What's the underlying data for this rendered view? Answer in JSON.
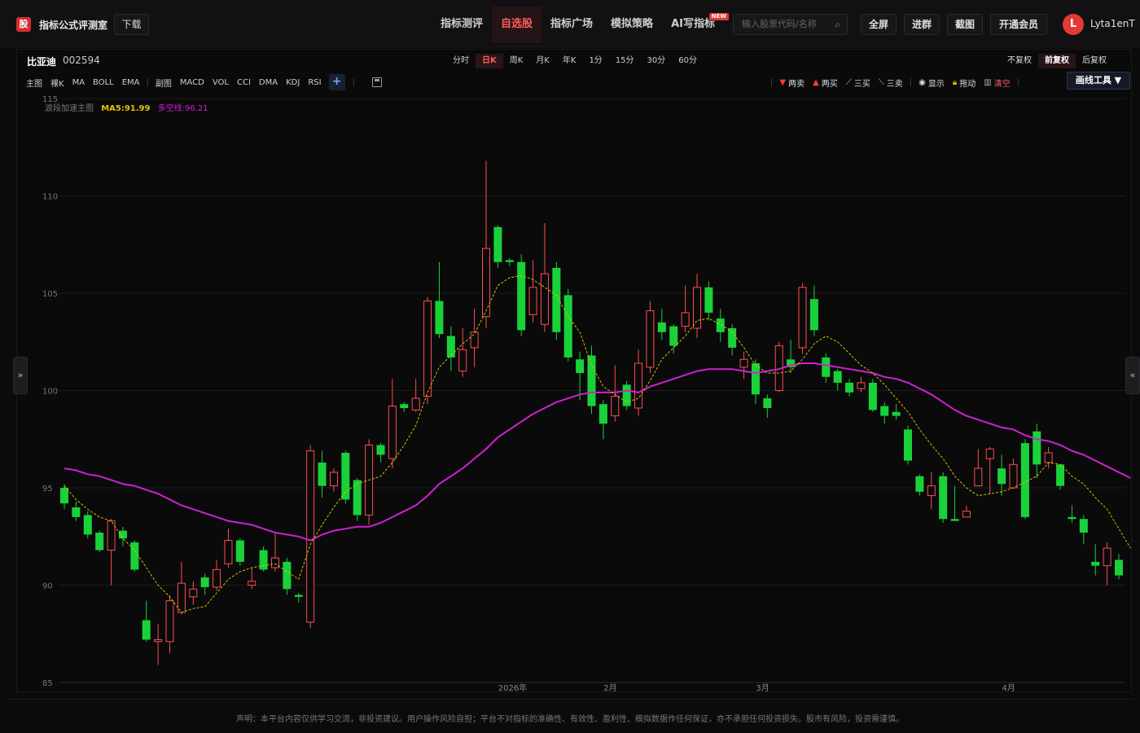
{
  "app": {
    "logo_glyph": "股",
    "title": "指标公式评测室",
    "download_label": "下载"
  },
  "nav": {
    "items": [
      {
        "label": "指标测评",
        "active": false
      },
      {
        "label": "自选股",
        "active": true
      },
      {
        "label": "指标广场",
        "active": false
      },
      {
        "label": "模拟策略",
        "active": false
      },
      {
        "label": "AI写指标",
        "active": false,
        "badge": "NEW"
      }
    ]
  },
  "search": {
    "placeholder": "输入股票代码/名称",
    "icon": "search-icon"
  },
  "top_buttons": {
    "fullscreen": "全屏",
    "join_group": "进群",
    "screenshot": "截图",
    "membership": "开通会员"
  },
  "user": {
    "avatar_letter": "L",
    "name": "Lyta1enT"
  },
  "stock": {
    "name": "比亚迪",
    "code": "002594"
  },
  "periods": [
    {
      "label": "分时",
      "active": false
    },
    {
      "label": "日K",
      "active": true
    },
    {
      "label": "周K",
      "active": false
    },
    {
      "label": "月K",
      "active": false
    },
    {
      "label": "年K",
      "active": false
    },
    {
      "label": "1分",
      "active": false
    },
    {
      "label": "15分",
      "active": false
    },
    {
      "label": "30分",
      "active": false
    },
    {
      "label": "60分",
      "active": false
    }
  ],
  "adjust_modes": [
    {
      "label": "不复权",
      "active": false
    },
    {
      "label": "前复权",
      "active": true
    },
    {
      "label": "后复权",
      "active": false
    }
  ],
  "main_indicators": {
    "group_label": "主图",
    "items": [
      "裸K",
      "MA",
      "BOLL",
      "EMA"
    ]
  },
  "sub_indicators": {
    "group_label": "副图",
    "items": [
      "MACD",
      "VOL",
      "CCI",
      "DMA",
      "KDJ",
      "RSI"
    ]
  },
  "add_label": "+",
  "draw_tools": {
    "items": [
      {
        "label": "两卖",
        "icon": "down-triangle-icon",
        "color": "#ff3b3b"
      },
      {
        "label": "两买",
        "icon": "up-triangle-icon",
        "color": "#ff3b3b"
      },
      {
        "label": "三买",
        "icon": "trend-line-icon"
      },
      {
        "label": "三卖",
        "icon": "diagonal-line-icon"
      },
      {
        "label": "显示",
        "icon": "eye-icon"
      },
      {
        "label": "拖动",
        "icon": "lock-icon"
      },
      {
        "label": "清空",
        "icon": "trash-icon",
        "color": "#ff5a5a"
      }
    ],
    "menu_label": "画线工具 ▼"
  },
  "side_buttons": {
    "left": "»",
    "right": "«"
  },
  "legend": {
    "main": "波段加速主图",
    "ma5": "MA5:91.99",
    "duokong": "多空线:96.21"
  },
  "chart_data": {
    "type": "candlestick",
    "ylim": [
      85,
      115
    ],
    "y_ticks": [
      85,
      90,
      95,
      100,
      105,
      110,
      115
    ],
    "x_labels": [
      {
        "label": "2026年",
        "index": 38
      },
      {
        "label": "2月",
        "index": 47
      },
      {
        "label": "3月",
        "index": 60
      },
      {
        "label": "4月",
        "index": 81
      }
    ],
    "up_color": "#ff4d4d",
    "down_color": "#19d23a",
    "ma5_color": "#d4c200",
    "duokong_color": "#d020d0",
    "candles": [
      [
        95.0,
        94.2,
        95.2,
        93.9
      ],
      [
        94.0,
        93.5,
        94.3,
        93.3
      ],
      [
        93.6,
        92.6,
        93.8,
        92.4
      ],
      [
        92.7,
        91.8,
        92.8,
        91.7
      ],
      [
        91.8,
        93.3,
        93.4,
        90.0
      ],
      [
        92.8,
        92.4,
        93.0,
        92.0
      ],
      [
        92.2,
        90.8,
        92.3,
        90.7
      ],
      [
        88.2,
        87.2,
        89.2,
        87.1
      ],
      [
        87.1,
        87.2,
        88.0,
        85.9
      ],
      [
        87.1,
        89.2,
        89.5,
        86.5
      ],
      [
        88.6,
        90.1,
        91.2,
        88.5
      ],
      [
        89.4,
        89.8,
        90.2,
        89.0
      ],
      [
        90.4,
        89.9,
        90.6,
        89.5
      ],
      [
        89.9,
        90.8,
        91.3,
        89.7
      ],
      [
        91.1,
        92.3,
        92.9,
        90.9
      ],
      [
        92.3,
        91.2,
        92.4,
        91.0
      ],
      [
        90.0,
        90.2,
        90.9,
        89.8
      ],
      [
        91.8,
        90.8,
        92.0,
        90.7
      ],
      [
        90.9,
        91.4,
        92.7,
        90.7
      ],
      [
        91.2,
        89.8,
        91.4,
        89.5
      ],
      [
        89.5,
        89.4,
        89.6,
        89.1
      ],
      [
        88.1,
        96.9,
        97.2,
        87.8
      ],
      [
        96.3,
        95.1,
        96.9,
        94.5
      ],
      [
        95.1,
        95.8,
        96.0,
        94.8
      ],
      [
        96.8,
        94.4,
        96.9,
        94.2
      ],
      [
        95.4,
        93.6,
        95.5,
        93.3
      ],
      [
        93.6,
        97.2,
        97.5,
        93.1
      ],
      [
        97.2,
        96.7,
        97.3,
        96.3
      ],
      [
        96.5,
        99.2,
        100.6,
        96.0
      ],
      [
        99.3,
        99.1,
        99.4,
        98.9
      ],
      [
        99.0,
        99.6,
        100.6,
        98.9
      ],
      [
        99.7,
        104.6,
        104.8,
        99.3
      ],
      [
        104.6,
        102.9,
        106.6,
        102.7
      ],
      [
        102.8,
        101.7,
        103.3,
        101.0
      ],
      [
        101.0,
        102.1,
        103.2,
        100.7
      ],
      [
        102.2,
        103.0,
        104.2,
        101.2
      ],
      [
        103.8,
        107.3,
        111.8,
        103.2
      ],
      [
        108.4,
        106.6,
        108.5,
        106.3
      ],
      [
        106.7,
        106.6,
        106.8,
        106.4
      ],
      [
        106.6,
        103.1,
        107.0,
        102.8
      ],
      [
        103.9,
        105.3,
        106.7,
        103.5
      ],
      [
        103.4,
        106.0,
        108.6,
        103.0
      ],
      [
        106.3,
        103.0,
        106.6,
        102.6
      ],
      [
        104.9,
        101.7,
        105.2,
        101.5
      ],
      [
        101.6,
        100.9,
        102.0,
        99.5
      ],
      [
        101.8,
        99.2,
        102.3,
        98.8
      ],
      [
        99.3,
        98.3,
        99.5,
        97.5
      ],
      [
        98.7,
        99.7,
        101.3,
        98.4
      ],
      [
        100.3,
        99.2,
        100.5,
        99.0
      ],
      [
        99.1,
        101.4,
        102.1,
        98.7
      ],
      [
        101.2,
        104.1,
        104.6,
        100.9
      ],
      [
        103.5,
        103.0,
        104.2,
        102.6
      ],
      [
        103.3,
        102.3,
        103.4,
        101.9
      ],
      [
        103.3,
        104.0,
        105.4,
        103.0
      ],
      [
        103.2,
        105.3,
        106.0,
        102.7
      ],
      [
        105.3,
        104.0,
        105.6,
        103.6
      ],
      [
        103.7,
        103.0,
        104.2,
        102.5
      ],
      [
        103.2,
        102.2,
        103.4,
        101.8
      ],
      [
        101.2,
        101.6,
        102.0,
        100.6
      ],
      [
        101.4,
        99.8,
        101.6,
        99.3
      ],
      [
        99.6,
        99.1,
        99.8,
        98.6
      ],
      [
        100.0,
        102.3,
        102.5,
        99.9
      ],
      [
        101.6,
        101.2,
        102.6,
        100.9
      ],
      [
        102.2,
        105.3,
        105.5,
        101.9
      ],
      [
        104.7,
        103.1,
        105.4,
        102.8
      ],
      [
        101.7,
        100.7,
        101.9,
        100.4
      ],
      [
        101.0,
        100.4,
        101.1,
        100.0
      ],
      [
        100.4,
        99.9,
        100.6,
        99.7
      ],
      [
        100.1,
        100.4,
        100.7,
        99.9
      ],
      [
        100.4,
        99.0,
        100.6,
        98.9
      ],
      [
        99.2,
        98.7,
        99.4,
        98.3
      ],
      [
        98.9,
        98.7,
        99.3,
        98.5
      ],
      [
        98.0,
        96.4,
        98.2,
        96.2
      ],
      [
        95.6,
        94.8,
        95.7,
        94.6
      ],
      [
        94.6,
        95.1,
        95.8,
        93.9
      ],
      [
        95.6,
        93.4,
        95.8,
        93.2
      ],
      [
        93.4,
        93.3,
        95.1,
        93.3
      ],
      [
        93.5,
        93.8,
        94.1,
        93.5
      ],
      [
        95.1,
        96.0,
        97.0,
        95.5
      ],
      [
        96.5,
        97.0,
        97.1,
        94.7
      ],
      [
        96.0,
        95.2,
        96.7,
        94.6
      ],
      [
        95.0,
        96.2,
        96.5,
        95.0
      ],
      [
        97.3,
        93.5,
        97.5,
        93.4
      ],
      [
        97.9,
        96.2,
        98.3,
        95.5
      ],
      [
        96.3,
        96.8,
        97.1,
        96.0
      ],
      [
        96.2,
        95.1,
        96.2,
        94.9
      ],
      [
        93.5,
        93.4,
        94.1,
        93.2
      ],
      [
        93.4,
        92.7,
        93.6,
        92.1
      ],
      [
        91.2,
        91.0,
        92.1,
        90.5
      ],
      [
        91.0,
        91.9,
        92.2,
        90.0
      ],
      [
        91.3,
        90.5,
        91.6,
        90.3
      ]
    ],
    "ma5": [
      95.1,
      94.4,
      93.9,
      93.5,
      93.3,
      92.4,
      91.8,
      90.9,
      90.0,
      89.4,
      88.6,
      88.8,
      88.9,
      89.6,
      90.3,
      90.7,
      90.9,
      91.0,
      91.1,
      90.7,
      90.3,
      92.1,
      93.1,
      94.0,
      94.8,
      95.2,
      95.4,
      95.6,
      96.3,
      97.2,
      98.2,
      99.9,
      101.2,
      101.8,
      102.4,
      102.9,
      104.1,
      105.4,
      105.8,
      105.9,
      105.7,
      105.3,
      104.9,
      103.8,
      103.0,
      101.3,
      100.2,
      99.8,
      99.4,
      99.6,
      100.5,
      101.6,
      102.2,
      102.8,
      103.6,
      103.7,
      103.4,
      103.0,
      102.2,
      101.3,
      100.9,
      100.9,
      101.0,
      101.6,
      102.4,
      102.8,
      102.5,
      101.9,
      101.3,
      100.9,
      100.3,
      99.6,
      98.9,
      98.0,
      97.2,
      96.5,
      95.6,
      95.0,
      94.6,
      94.7,
      94.8,
      95.0,
      95.3,
      95.6,
      96.3,
      96.2,
      95.6,
      95.2,
      94.5,
      93.9,
      92.9,
      91.9
    ],
    "duokong": [
      96.0,
      95.9,
      95.7,
      95.6,
      95.4,
      95.2,
      95.1,
      94.9,
      94.7,
      94.4,
      94.1,
      93.9,
      93.7,
      93.5,
      93.3,
      93.2,
      93.1,
      92.9,
      92.7,
      92.6,
      92.5,
      92.3,
      92.6,
      92.8,
      92.9,
      93.0,
      93.0,
      93.2,
      93.5,
      93.8,
      94.1,
      94.6,
      95.2,
      95.6,
      96.0,
      96.5,
      97.0,
      97.6,
      98.0,
      98.4,
      98.8,
      99.1,
      99.4,
      99.6,
      99.8,
      99.9,
      99.9,
      99.9,
      100.0,
      99.9,
      100.2,
      100.4,
      100.6,
      100.8,
      101.0,
      101.1,
      101.1,
      101.1,
      101.0,
      100.9,
      101.0,
      101.1,
      101.3,
      101.4,
      101.4,
      101.3,
      101.2,
      101.1,
      101.0,
      100.9,
      100.7,
      100.6,
      100.4,
      100.1,
      99.8,
      99.4,
      99.0,
      98.7,
      98.5,
      98.3,
      98.1,
      98.0,
      97.7,
      97.5,
      97.4,
      97.2,
      96.9,
      96.7,
      96.4,
      96.1,
      95.8,
      95.5
    ]
  },
  "disclaimer": "声明：本平台内容仅供学习交流，非投资建议。用户操作风险自担；平台不对指标的准确性、有效性、盈利性、模拟数据作任何保证，亦不承担任何投资损失。股市有风险，投资需谨慎。"
}
